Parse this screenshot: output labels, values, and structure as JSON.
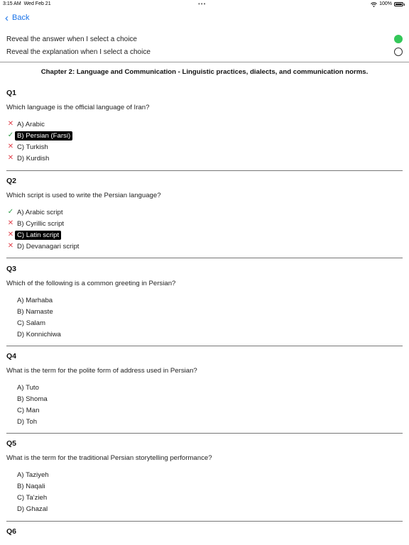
{
  "status_bar": {
    "time": "3:15 AM",
    "date": "Wed Feb 21",
    "dots": "•••",
    "battery": "100%"
  },
  "nav": {
    "back_label": "Back"
  },
  "settings": [
    {
      "label": "Reveal the answer when I select a choice",
      "on": true
    },
    {
      "label": "Reveal the explanation when I select a choice",
      "on": false
    }
  ],
  "chapter_title": "Chapter 2: Language and Communication - Linguistic practices, dialects, and communication norms.",
  "questions": [
    {
      "num": "Q1",
      "text": "Which language is the official language of Iran?",
      "choices": [
        {
          "text": "A) Arabic",
          "mark": "x",
          "selected": false
        },
        {
          "text": "B) Persian (Farsi)",
          "mark": "check",
          "selected": true
        },
        {
          "text": "C) Turkish",
          "mark": "x",
          "selected": false
        },
        {
          "text": "D) Kurdish",
          "mark": "x",
          "selected": false
        }
      ]
    },
    {
      "num": "Q2",
      "text": "Which script is used to write the Persian language?",
      "choices": [
        {
          "text": "A) Arabic script",
          "mark": "check",
          "selected": false
        },
        {
          "text": "B) Cyrillic script",
          "mark": "x",
          "selected": false
        },
        {
          "text": "C) Latin script",
          "mark": "x",
          "selected": true
        },
        {
          "text": "D) Devanagari script",
          "mark": "x",
          "selected": false
        }
      ]
    },
    {
      "num": "Q3",
      "text": "Which of the following is a common greeting in Persian?",
      "choices": [
        {
          "text": "A) Marhaba",
          "mark": "",
          "selected": false
        },
        {
          "text": "B) Namaste",
          "mark": "",
          "selected": false
        },
        {
          "text": "C) Salam",
          "mark": "",
          "selected": false
        },
        {
          "text": "D) Konnichiwa",
          "mark": "",
          "selected": false
        }
      ]
    },
    {
      "num": "Q4",
      "text": "What is the term for the polite form of address used in Persian?",
      "choices": [
        {
          "text": "A) Tuto",
          "mark": "",
          "selected": false
        },
        {
          "text": "B) Shoma",
          "mark": "",
          "selected": false
        },
        {
          "text": "C) Man",
          "mark": "",
          "selected": false
        },
        {
          "text": "D) Toh",
          "mark": "",
          "selected": false
        }
      ]
    },
    {
      "num": "Q5",
      "text": "What is the term for the traditional Persian storytelling performance?",
      "choices": [
        {
          "text": "A) Taziyeh",
          "mark": "",
          "selected": false
        },
        {
          "text": "B) Naqali",
          "mark": "",
          "selected": false
        },
        {
          "text": "C) Ta'zieh",
          "mark": "",
          "selected": false
        },
        {
          "text": "D) Ghazal",
          "mark": "",
          "selected": false
        }
      ]
    },
    {
      "num": "Q6",
      "text": "",
      "choices": []
    }
  ],
  "colors": {
    "accent": "#1a73e8",
    "toggle_on": "#34c759",
    "wrong": "#e0414b",
    "correct": "#2e9b47"
  }
}
